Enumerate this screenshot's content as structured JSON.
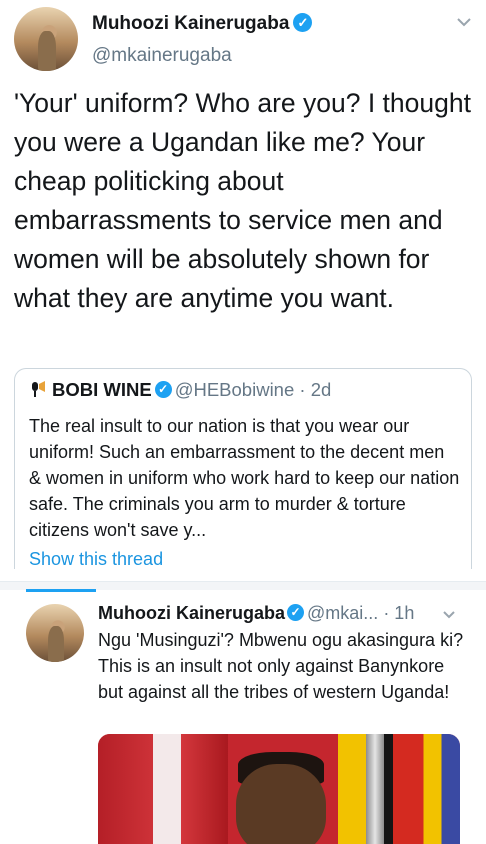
{
  "tweet": {
    "author_name": "Muhoozi Kainerugaba",
    "author_handle": "@mkainerugaba",
    "text": "'Your' uniform? Who are you? I thought you were a Ugandan like me? Your cheap politicking about embarrassments to service men and women will be absolutely shown for what they are anytime you want."
  },
  "quote": {
    "author_name": "BOBI WINE",
    "author_handle": "@HEBobiwine",
    "time": "· 2d",
    "text": "The real insult to our nation is that you wear our uniform! Such an embarrassment to the decent men & women in uniform who work hard to keep our nation safe. The criminals you arm to murder & torture citizens won't save y...",
    "show_thread": "Show this thread"
  },
  "reply": {
    "author_name": "Muhoozi Kainerugaba",
    "author_handle": "@mkai...",
    "time": "· 1h",
    "text": "Ngu 'Musinguzi'? Mbwenu ogu akasingura ki? This is an insult not only against Banynkore but against all the tribes of western Uganda!"
  },
  "icons": {
    "verified": "verified-check-icon",
    "caret": "chevron-down-icon",
    "mic": "microphone-icon"
  },
  "colors": {
    "link": "#1b95e0",
    "verified": "#1da1f2",
    "handle": "#657786",
    "text": "#14171a"
  }
}
